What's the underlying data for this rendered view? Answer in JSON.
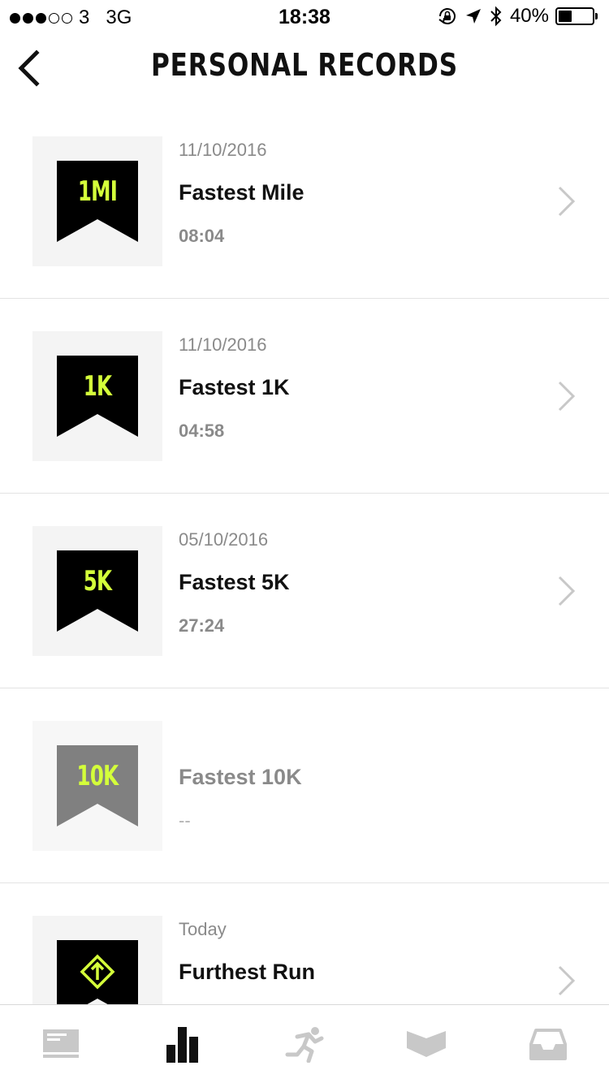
{
  "status_bar": {
    "carrier": "3",
    "network": "3G",
    "time": "18:38",
    "battery_text": "40%",
    "battery_level": 0.4,
    "signal_bars_filled": 3,
    "signal_bars_total": 5
  },
  "header": {
    "title": "PERSONAL RECORDS",
    "back_icon": "chevron-left-icon"
  },
  "colors": {
    "badge_accent": "#d4ff3a",
    "badge_dark": "#000000",
    "badge_disabled": "#808080",
    "muted_text": "#8a8a8a"
  },
  "records": [
    {
      "badge": "1MI",
      "date": "11/10/2016",
      "title": "Fastest Mile",
      "value": "08:04",
      "achieved": true
    },
    {
      "badge": "1K",
      "date": "11/10/2016",
      "title": "Fastest 1K",
      "value": "04:58",
      "achieved": true
    },
    {
      "badge": "5K",
      "date": "05/10/2016",
      "title": "Fastest 5K",
      "value": "27:24",
      "achieved": true
    },
    {
      "badge": "10K",
      "date": "",
      "title": "Fastest 10K",
      "value": "--",
      "achieved": false
    },
    {
      "badge_icon": "route-arrow-icon",
      "date": "Today",
      "title": "Furthest Run",
      "value": "",
      "achieved": true
    }
  ],
  "tab_bar": {
    "tabs": [
      {
        "icon": "feed-icon",
        "active": false
      },
      {
        "icon": "activity-bars-icon",
        "active": true
      },
      {
        "icon": "runner-icon",
        "active": false
      },
      {
        "icon": "achievements-icon",
        "active": false
      },
      {
        "icon": "inbox-icon",
        "active": false
      }
    ]
  }
}
